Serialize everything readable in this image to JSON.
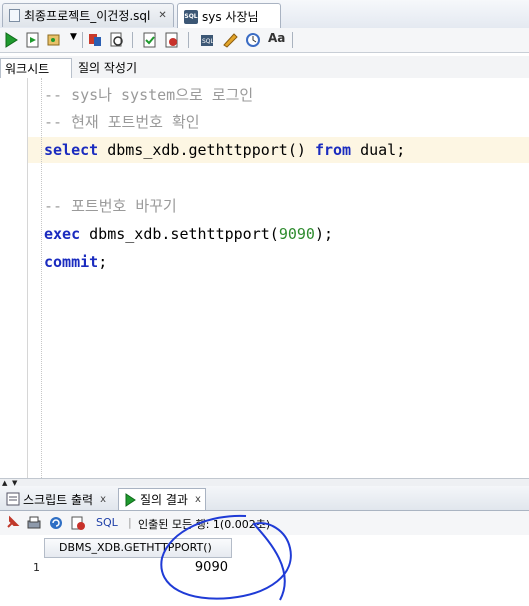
{
  "doc_tabs": [
    {
      "label": "최종프로젝트_이건정.sql",
      "active": false
    },
    {
      "label": "sys 사장님",
      "active": true
    }
  ],
  "sub_tabs": {
    "worksheet": "워크시트",
    "query_builder": "질의 작성기"
  },
  "code_lines": [
    {
      "text": "-- sys나 system으로 로그인"
    },
    {
      "text": "-- 현재 포트번호 확인"
    },
    {
      "parts": [
        "select",
        " dbms_xdb.gethttpport() ",
        "from",
        " dual;"
      ]
    },
    {
      "text": ""
    },
    {
      "text": "-- 포트번호 바꾸기"
    },
    {
      "parts": [
        "exec",
        " dbms_xdb.sethttpport(",
        "9090",
        ");"
      ]
    },
    {
      "parts": [
        "commit",
        ";"
      ]
    }
  ],
  "bottom_tabs": [
    {
      "label": "스크립트 출력",
      "active": false
    },
    {
      "label": "질의 결과",
      "active": true
    }
  ],
  "results_toolbar": {
    "sql_label": "SQL",
    "status": "인출된 모든 행: 1(0.002초)"
  },
  "grid": {
    "column": "DBMS_XDB.GETHTTPPORT()",
    "rows": [
      {
        "num": "1",
        "value": "9090"
      }
    ]
  },
  "colors": {
    "keyword": "#1a2bbf",
    "comment": "#9a9a9a",
    "number": "#2e8b2e",
    "annotation": "#1f3bd6"
  }
}
